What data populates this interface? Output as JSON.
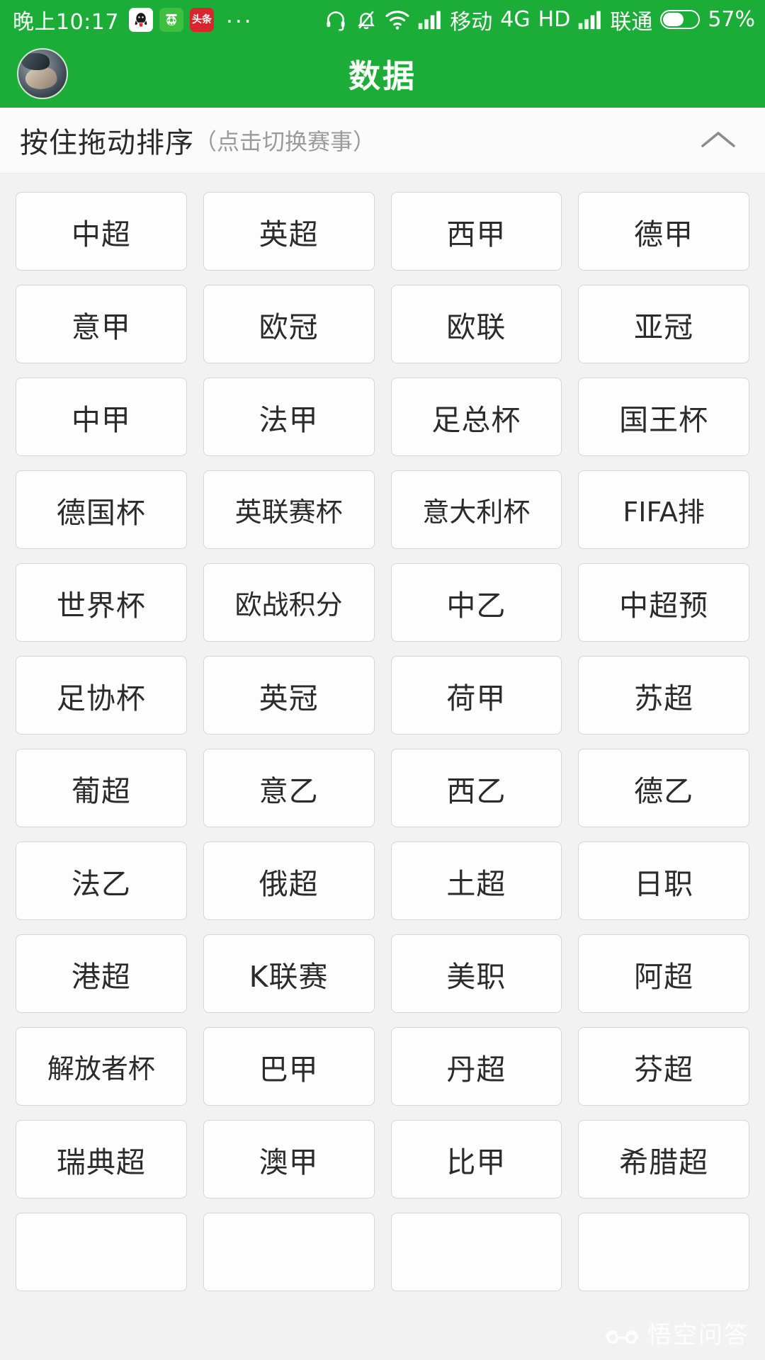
{
  "status_bar": {
    "time": "晚上10:17",
    "app_icons": [
      "qq-icon",
      "soccer-app-icon",
      "toutiao-icon"
    ],
    "overflow": "...",
    "headset_icon": "headset-icon",
    "mute_icon": "bell-muted-icon",
    "wifi_icon": "wifi-icon",
    "signal_icon_1": "signal-bars-icon",
    "carrier_1": "移动",
    "network_type": "4G",
    "hd_label": "HD",
    "signal_icon_2": "signal-bars-icon",
    "carrier_2": "联通",
    "battery_icon": "battery-icon",
    "battery_percent": "57%",
    "toutiao_label": "头条"
  },
  "header": {
    "avatar": "user-avatar",
    "title": "数据"
  },
  "section": {
    "title": "按住拖动排序",
    "subtitle": "（点击切换赛事）",
    "collapse_icon": "chevron-up-icon"
  },
  "grid": {
    "items": [
      "中超",
      "英超",
      "西甲",
      "德甲",
      "意甲",
      "欧冠",
      "欧联",
      "亚冠",
      "中甲",
      "法甲",
      "足总杯",
      "国王杯",
      "德国杯",
      "英联赛杯",
      "意大利杯",
      "FIFA排",
      "世界杯",
      "欧战积分",
      "中乙",
      "中超预",
      "足协杯",
      "英冠",
      "荷甲",
      "苏超",
      "葡超",
      "意乙",
      "西乙",
      "德乙",
      "法乙",
      "俄超",
      "土超",
      "日职",
      "港超",
      "K联赛",
      "美职",
      "阿超",
      "解放者杯",
      "巴甲",
      "丹超",
      "芬超",
      "瑞典超",
      "澳甲",
      "比甲",
      "希腊超",
      "",
      "",
      "",
      ""
    ]
  },
  "watermark": {
    "text": "悟空问答",
    "logo": "wukong-cloud-logo"
  },
  "colors": {
    "brand_green": "#1cad38",
    "page_bg": "#f2f2f2",
    "card_bg": "#fdfdfd",
    "card_border": "#d6d6d6",
    "text_primary": "#2b2b2b",
    "text_muted": "#9b9b9b"
  }
}
